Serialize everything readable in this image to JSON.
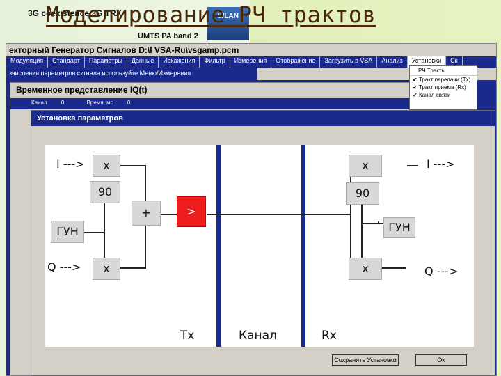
{
  "slide": {
    "title": "Моделирование РЧ трактов",
    "bg_text_1": "3G coexistence 3G TRX",
    "bg_text_2": "UMTS PA band 2",
    "badge": "WLAN"
  },
  "main_window": {
    "title": "екторный Генератор Сигналов  D:\\l  VSA-Ru\\vsgamp.pcm",
    "menu": [
      {
        "label": "Модуляция"
      },
      {
        "label": "Стандарт"
      },
      {
        "label": "Параметры"
      },
      {
        "label": "Данные"
      },
      {
        "label": "Искажения"
      },
      {
        "label": "Фильтр"
      },
      {
        "label": "Измерения"
      },
      {
        "label": "Отображение"
      },
      {
        "label": "Загрузить в VSA"
      },
      {
        "label": "Анализ"
      },
      {
        "label": "Установки"
      },
      {
        "label": "Ск"
      }
    ],
    "hint": "зчисления параметров сигнала используйте Меню/Измерения"
  },
  "dropdown": {
    "header": "РЧ Тракты",
    "items": [
      {
        "label": "Тракт передачи (Tx)"
      },
      {
        "label": "Тракт приема (Rx)"
      },
      {
        "label": "Канал связи"
      }
    ],
    "checkmark": "✔"
  },
  "iq_window": {
    "title": "Временное представление IQ(t)",
    "channel_label": "Канал",
    "channel_value": "0",
    "time_label": "Время, мс",
    "time_value": "0"
  },
  "dialog": {
    "title": "Установка параметров",
    "save_button": "Сохранить Установки",
    "ok_button": "Ok"
  },
  "diagram": {
    "tx": {
      "i_in": "I --->",
      "q_in": "Q --->",
      "mult": "x",
      "phase": "90",
      "osc": "ГУН",
      "sum": "+",
      "amp": ">",
      "label": "Tx"
    },
    "channel": {
      "label": "Канал"
    },
    "rx": {
      "i_out": "I --->",
      "q_out": "Q --->",
      "mult": "x",
      "phase": "90",
      "osc": "ГУН",
      "label": "Rx"
    }
  },
  "colors": {
    "app_blue": "#1a2a8c",
    "amp_red": "#ee1c1c",
    "title_brown": "#4a2608"
  }
}
